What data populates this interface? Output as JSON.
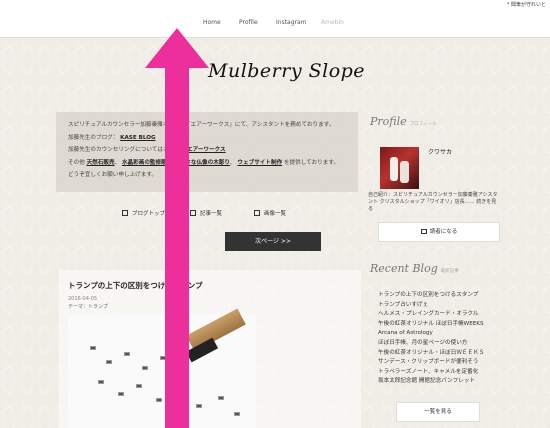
{
  "topbar": {
    "notice": "* 聞筆が守れいと"
  },
  "nav": {
    "items": [
      {
        "label": "Home"
      },
      {
        "label": "Profile"
      },
      {
        "label": "Instagram"
      },
      {
        "label": "Ameblo"
      }
    ]
  },
  "blog": {
    "title": "Mulberry Slope"
  },
  "intro": {
    "line1": "スピリチュアルカウンセラー加藤秦雅オフィス「エアーワークス」にて、アシスタントを務めております。",
    "blog_label": "加藤先生のブログ：",
    "blog_link": "KASE BLOG",
    "counsel_label": "加藤先生のカウンセリングについてはこちら：",
    "counsel_link": "エアーワークス",
    "other_prefix": "その他",
    "link_a": "天然石販売",
    "link_b": "水晶彩画の監修販売",
    "link_c": "小さな仏像の木彫り",
    "link_d": "ウェブサイト制作",
    "other_suffix": "を提供しております。",
    "closing": "どうぞ宜しくお願い申し上げます。"
  },
  "minilinks": {
    "top": "ブログトップ",
    "articles": "記事一覧",
    "images": "画像一覧"
  },
  "pager": {
    "next": "次ページ >>"
  },
  "post": {
    "title": "トランプの上下の区別をつけるスタンプ",
    "date": "2016-04-05",
    "theme": "テーマ：トランプ"
  },
  "sidebar": {
    "profile_head": "Profile",
    "profile_sub": "プロフィール",
    "name": "クワサカ",
    "bio": "自己紹介：スピリチュアルカウンセラー加藤秦雅アシスタント クリスタルショップ「ワイオリ」店長……",
    "bio_tail": "続きを見る",
    "reader_button": "読者になる",
    "recent_head": "Recent Blog",
    "recent_sub": "最新記事",
    "recent": [
      "トランプの上下の区別をつけるスタンプ",
      "トランプ占いすげぇ",
      "ヘルメス・プレイングカード・オラクル",
      "午後の紅茶オリジナル ほぼ日手帳WEEKS",
      "Arcana of Astrology",
      "ほぼ日手帳、月の星ページの使い方",
      "午後の紅茶オリジナル・ほぼ日ＷＥＥＫＳ",
      "サンデース・クリップボードが便利そう",
      "トラベラーズノート、キャメルを定番化",
      "坂本太郎記念館 開館記念パンフレット"
    ],
    "list_button": "一覧を見る"
  },
  "colors": {
    "arrow": "#ec2f9b",
    "accent_dark": "#333333"
  }
}
